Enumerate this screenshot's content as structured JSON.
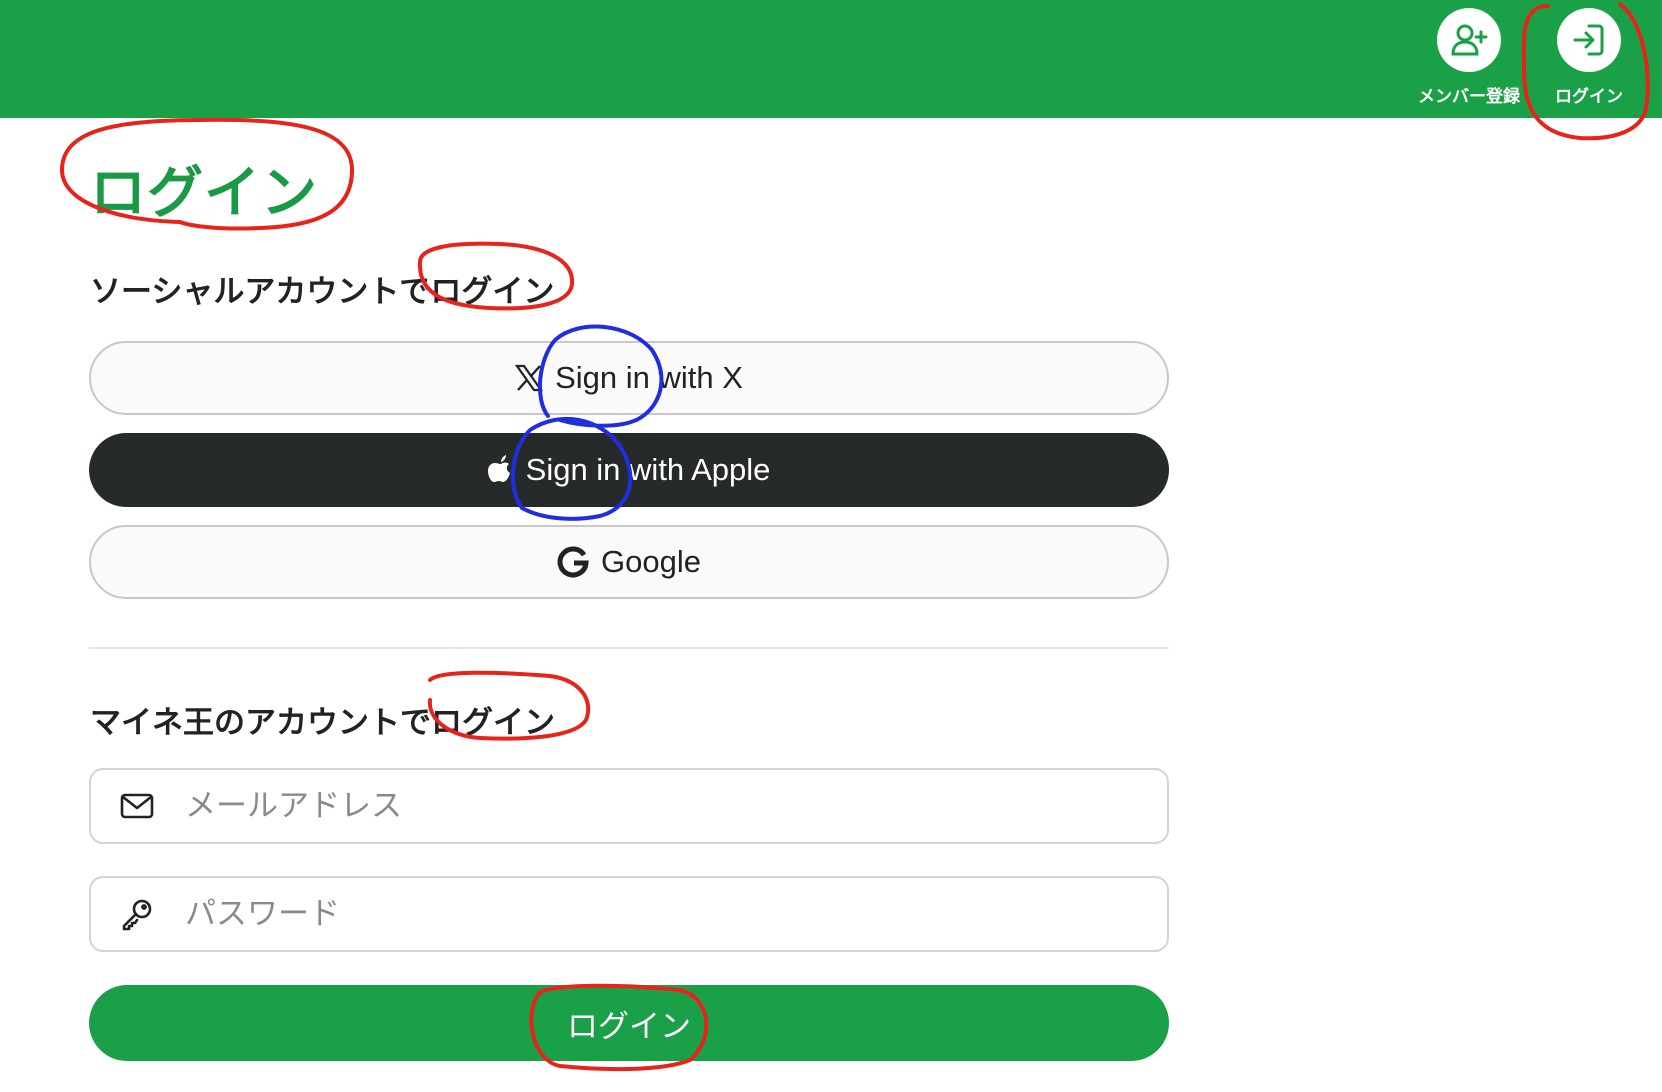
{
  "header": {
    "register_label": "メンバー登録",
    "login_label": "ログイン",
    "register_icon": "user-plus-icon",
    "login_icon": "login-arrow-icon",
    "bg_color": "#1aa148"
  },
  "page": {
    "title": "ログイン"
  },
  "social": {
    "heading": "ソーシャルアカウントでログイン",
    "x_label": "Sign in with X",
    "apple_label": "Sign in with Apple",
    "google_label": "Google"
  },
  "mine": {
    "heading": "マイネ王のアカウントでログイン",
    "email_placeholder": "メールアドレス",
    "password_placeholder": "パスワード",
    "submit_label": "ログイン"
  },
  "colors": {
    "brand_green": "#1aa148",
    "apple_dark": "#262a2a",
    "annotation_red": "#e8231b",
    "annotation_blue": "#1f2fe0"
  }
}
